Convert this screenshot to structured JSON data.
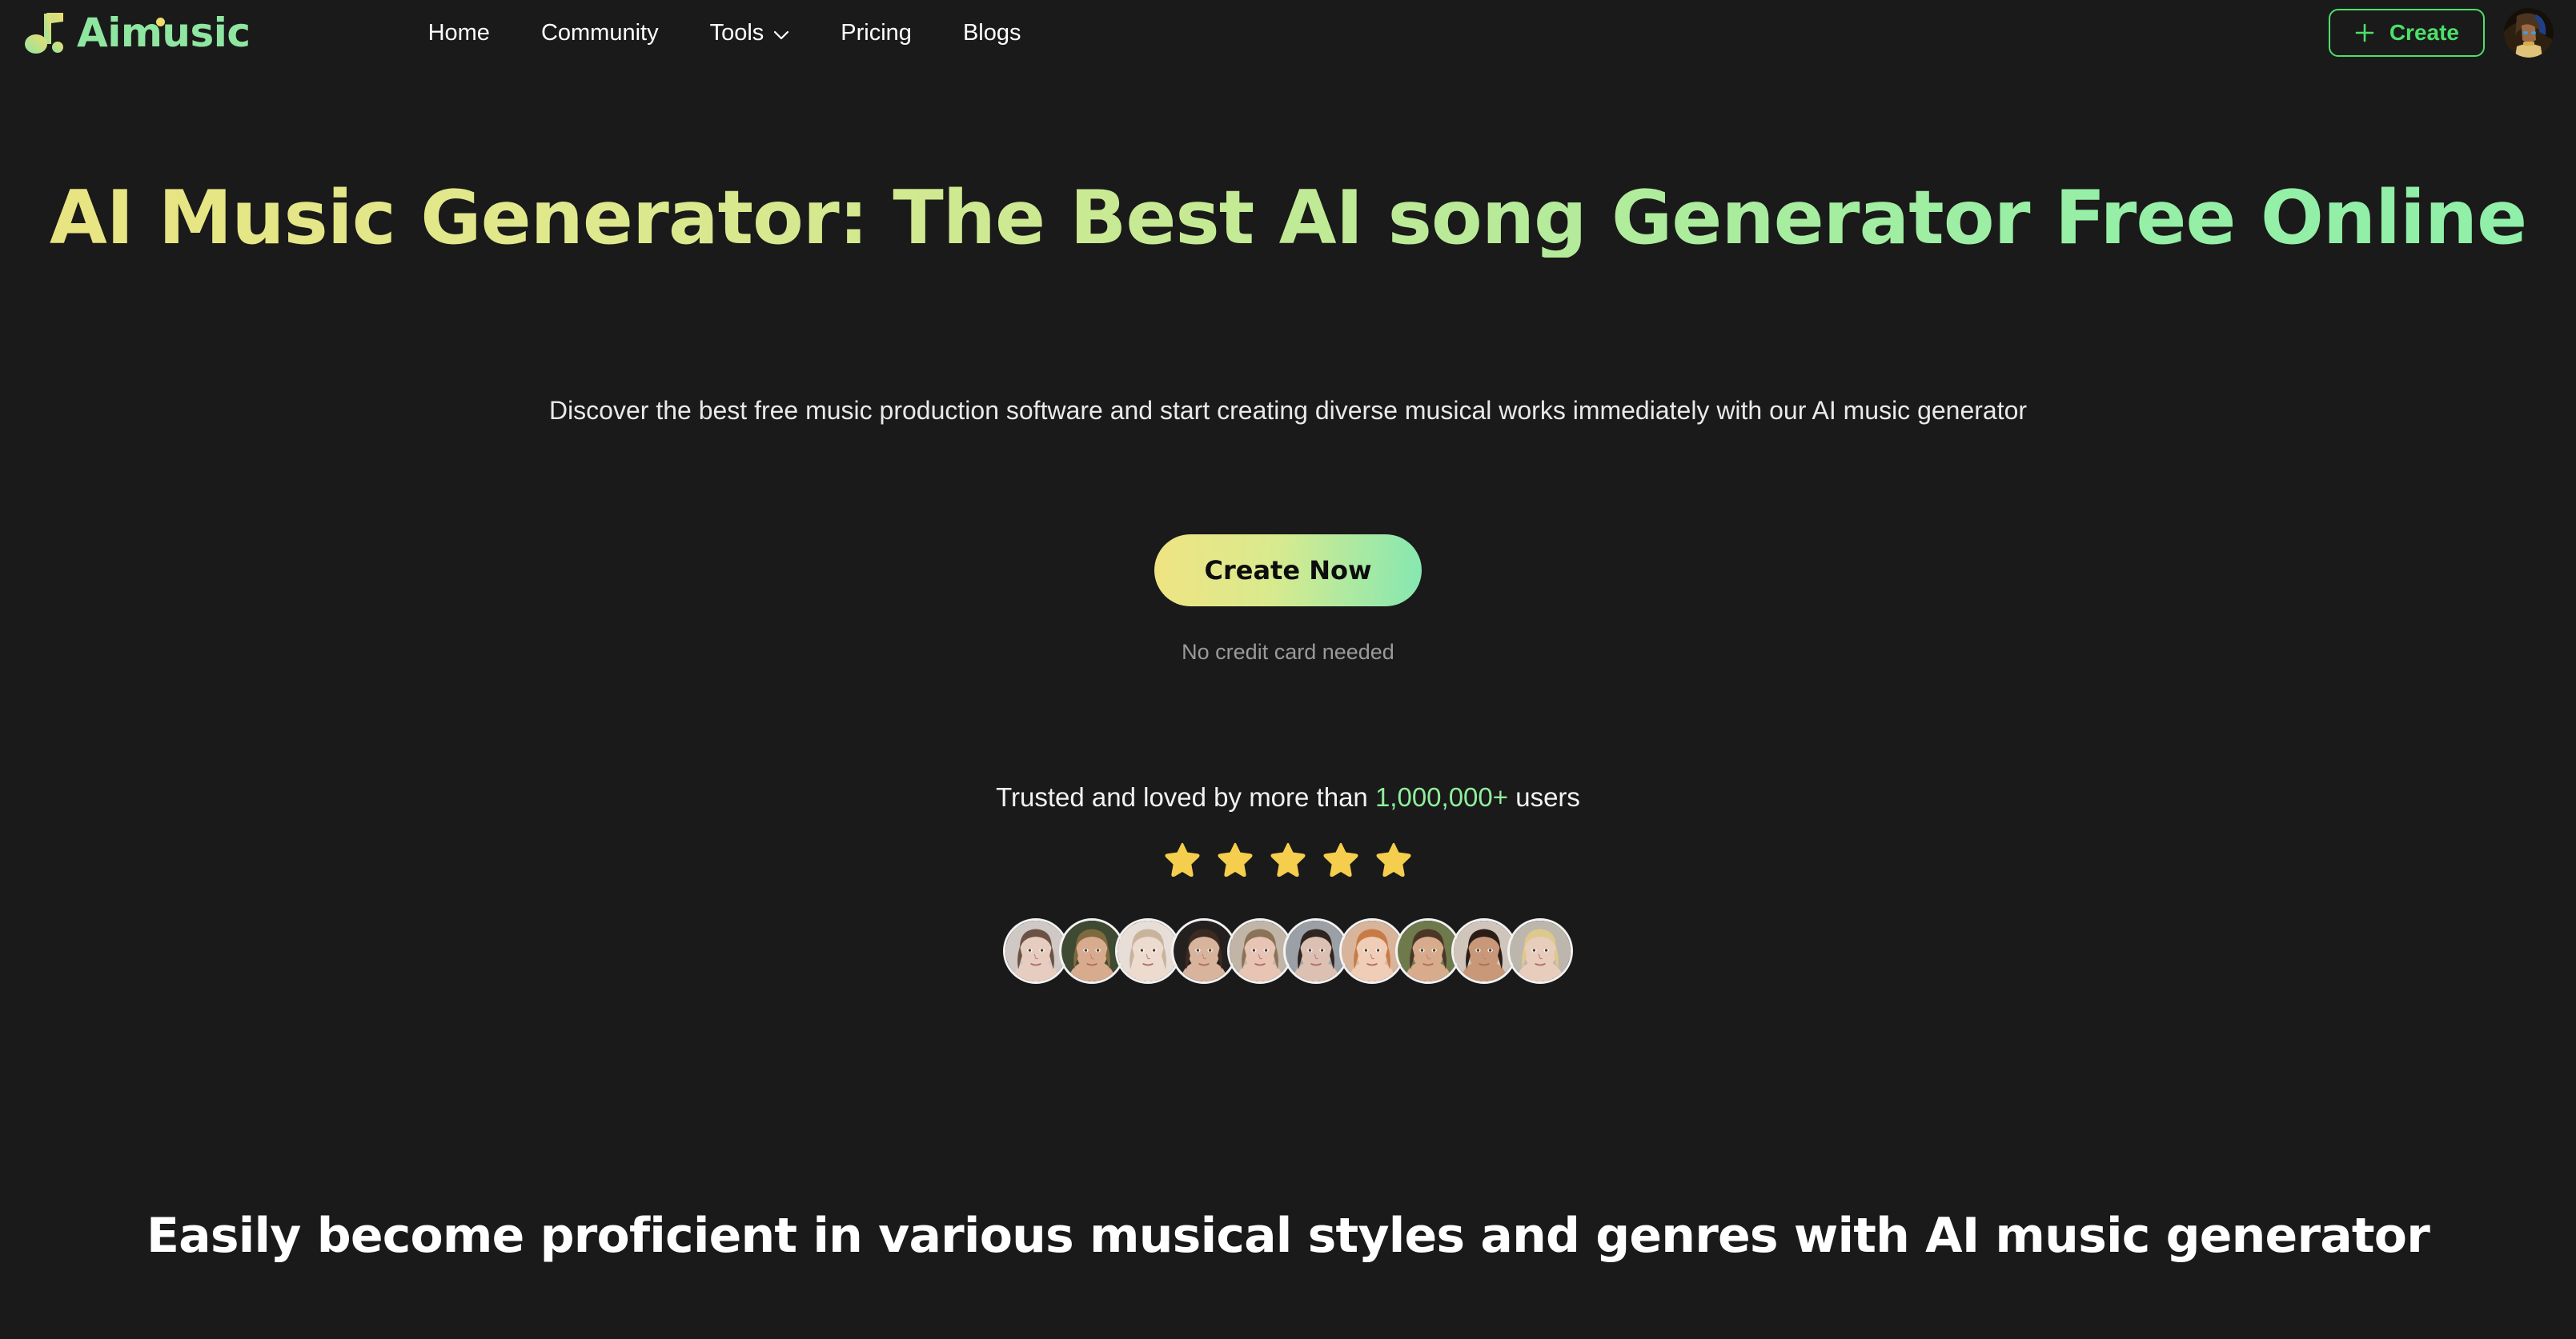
{
  "brand": {
    "name": "Aimusic",
    "logo_icon": "music-note-icon",
    "logo_gradient_from": "#F0DC6E",
    "logo_gradient_to": "#8EE6A0"
  },
  "nav": {
    "items": [
      {
        "label": "Home",
        "has_dropdown": false
      },
      {
        "label": "Community",
        "has_dropdown": false
      },
      {
        "label": "Tools",
        "has_dropdown": true,
        "icon": "chevron-down-icon"
      },
      {
        "label": "Pricing",
        "has_dropdown": false
      },
      {
        "label": "Blogs",
        "has_dropdown": false
      }
    ]
  },
  "header_actions": {
    "create_label": "Create",
    "create_icon": "plus-icon",
    "create_accent": "#4CE06A",
    "avatar": "user-avatar"
  },
  "hero": {
    "headline": "AI Music Generator: The Best AI song Generator Free Online",
    "headline_gradient_from": "#EAE481",
    "headline_gradient_to": "#8FEFA8",
    "subtitle": "Discover the best free music production software and start creating diverse musical works immediately with our AI music generator",
    "cta_label": "Create Now",
    "cta_gradient_from": "#F0E483",
    "cta_gradient_to": "#84E8B2",
    "cta_note": "No credit card needed"
  },
  "social_proof": {
    "trust_prefix": "Trusted and loved by more than ",
    "trust_count": "1,000,000+",
    "trust_suffix": " users",
    "trust_count_color": "#90EE9B",
    "star_count": 5,
    "star_color": "#F5CE4D",
    "avatar_count": 10,
    "avatars": [
      {
        "name": "user-avatar-1",
        "skin": "#e6cdc0",
        "hair": "#6b5244",
        "bg": "#cfc8c4"
      },
      {
        "name": "user-avatar-2",
        "skin": "#d9ab8e",
        "hair": "#7d6a3f",
        "bg": "#3f4a32"
      },
      {
        "name": "user-avatar-3",
        "skin": "#eedbd0",
        "hair": "#c8b39c",
        "bg": "#e7ded7"
      },
      {
        "name": "user-avatar-4",
        "skin": "#d8b49c",
        "hair": "#3a2a22",
        "bg": "#252020"
      },
      {
        "name": "user-avatar-5",
        "skin": "#e7c4b4",
        "hair": "#8a7356",
        "bg": "#c0b5a6"
      },
      {
        "name": "user-avatar-6",
        "skin": "#dcc0b2",
        "hair": "#2f2420",
        "bg": "#9aa0a6"
      },
      {
        "name": "user-avatar-7",
        "skin": "#f0cdb6",
        "hair": "#c87b44",
        "bg": "#d8b49a"
      },
      {
        "name": "user-avatar-8",
        "skin": "#d8ab8c",
        "hair": "#4a3726",
        "bg": "#6e7a4c"
      },
      {
        "name": "user-avatar-9",
        "skin": "#c89878",
        "hair": "#2a1d18",
        "bg": "#cfc5bb"
      },
      {
        "name": "user-avatar-10",
        "skin": "#e8cdbc",
        "hair": "#ddc98c",
        "bg": "#bdb6ad"
      }
    ]
  },
  "section": {
    "heading": "Easily become proficient in various musical styles and genres with AI music generator"
  }
}
